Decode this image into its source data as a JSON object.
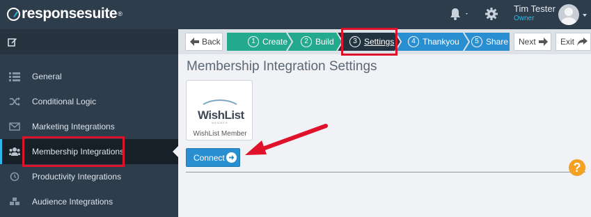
{
  "app": {
    "logo_text": "responsesuite",
    "logo_reg": "®"
  },
  "user": {
    "name": "Tim Tester",
    "role": "Owner"
  },
  "sidebar": {
    "items": [
      {
        "label": "General",
        "icon": "list-icon",
        "active": false
      },
      {
        "label": "Conditional Logic",
        "icon": "shuffle-icon",
        "active": false
      },
      {
        "label": "Marketing Integrations",
        "icon": "envelope-icon",
        "active": false
      },
      {
        "label": "Membership Integrations",
        "icon": "users-icon",
        "active": true
      },
      {
        "label": "Productivity Integrations",
        "icon": "clock-icon",
        "active": false
      },
      {
        "label": "Audience Integrations",
        "icon": "cubes-icon",
        "active": false
      }
    ]
  },
  "wizard": {
    "back_label": "Back",
    "next_label": "Next",
    "exit_label": "Exit",
    "steps": [
      {
        "num": "1",
        "label": "Create",
        "state": "done"
      },
      {
        "num": "2",
        "label": "Build",
        "state": "done"
      },
      {
        "num": "3",
        "label": "Settings",
        "state": "current"
      },
      {
        "num": "4",
        "label": "Thankyou",
        "state": "todo"
      },
      {
        "num": "5",
        "label": "Share",
        "state": "todo"
      }
    ]
  },
  "main": {
    "title": "Membership Integration Settings",
    "integration": {
      "logo_word": "WishList",
      "logo_sub": "MEMBER",
      "label": "WishList Member"
    },
    "connect_label": "Connect",
    "help_label": "?"
  },
  "colors": {
    "topbar": "#2e3d4c",
    "step_done": "#23a98e",
    "step_current": "#233441",
    "step_todo": "#2a8fd0",
    "accent": "#2fb8e9",
    "annotation": "#e0112b",
    "help": "#f4a022"
  }
}
